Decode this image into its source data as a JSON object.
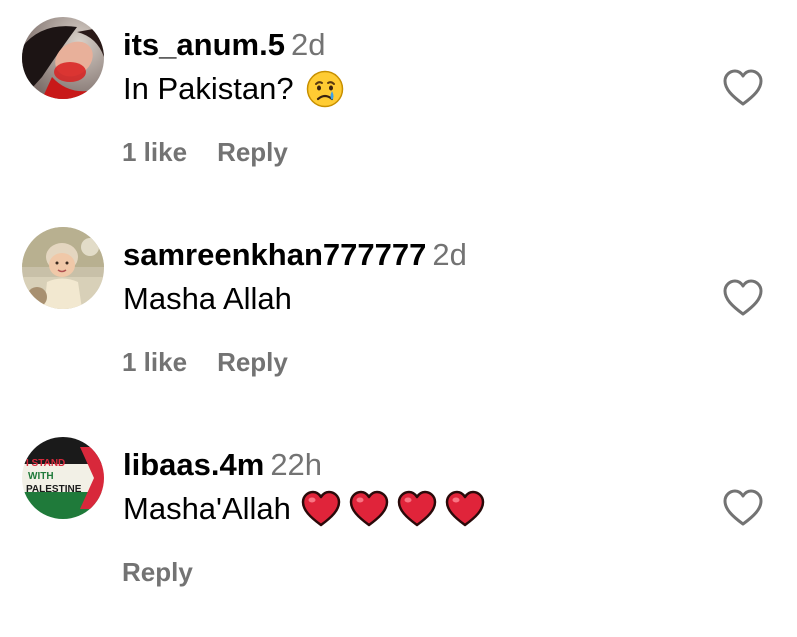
{
  "comments": [
    {
      "username": "its_anum.5",
      "time": "2d",
      "text": "In Pakistan?",
      "emoji": "crying-face",
      "likes": "1 like",
      "reply": "Reply",
      "avatar": "woman-portrait-avatar"
    },
    {
      "username": "samreenkhan777777",
      "time": "2d",
      "text": "Masha Allah",
      "emoji": "",
      "likes": "1 like",
      "reply": "Reply",
      "avatar": "baby-photo-avatar"
    },
    {
      "username": "libaas.4m",
      "time": "22h",
      "text": "Masha'Allah",
      "emoji": "red-heart x4",
      "likes": "",
      "reply": "Reply",
      "avatar": "palestine-flag-avatar",
      "avatar_text": [
        "I STAND",
        "WITH",
        "PALESTINE"
      ]
    }
  ],
  "colors": {
    "username": "#000000",
    "secondary": "#737373",
    "heart": "#e0243a",
    "flag_black": "#1a1a1a",
    "flag_green": "#1f7a3a",
    "flag_red": "#d8283b"
  },
  "icons": {
    "like": "heart-outline-icon"
  }
}
